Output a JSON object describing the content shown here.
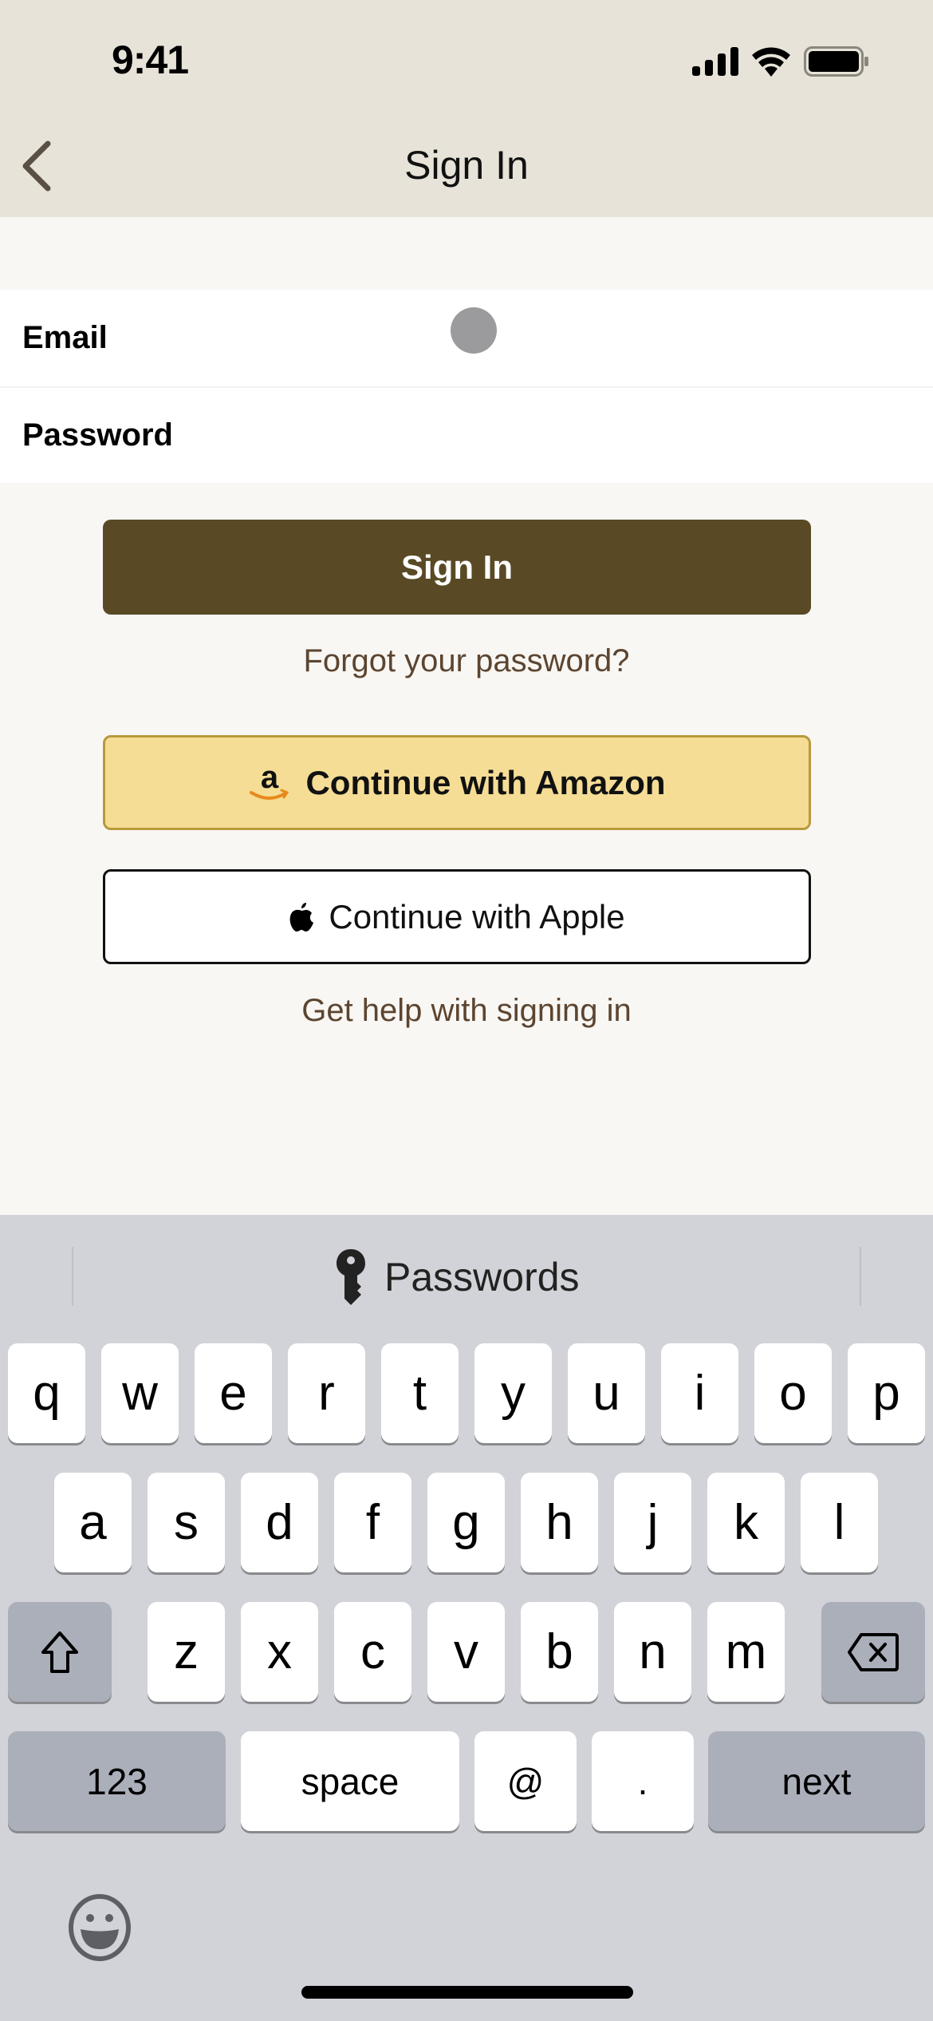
{
  "status_bar": {
    "time": "9:41"
  },
  "nav": {
    "title": "Sign In",
    "back_icon": "chevron-left-icon"
  },
  "form": {
    "email": {
      "label": "Email",
      "value": "",
      "placeholder": ""
    },
    "password": {
      "label": "Password",
      "value": "",
      "placeholder": ""
    }
  },
  "actions": {
    "sign_in": "Sign In",
    "forgot_password": "Forgot your password?",
    "amazon": "Continue with Amazon",
    "apple": "Continue with Apple",
    "help": "Get help with signing in"
  },
  "colors": {
    "header_bg": "#e7e3d8",
    "page_bg": "#f9f7f4",
    "primary": "#594a25",
    "amazon_bg": "#f5dd95",
    "amazon_border": "#b89a3e",
    "link": "#5c4530",
    "keyboard_bg": "#d2d3d8"
  },
  "keyboard": {
    "suggestion": "Passwords",
    "row1": [
      "q",
      "w",
      "e",
      "r",
      "t",
      "y",
      "u",
      "i",
      "o",
      "p"
    ],
    "row2": [
      "a",
      "s",
      "d",
      "f",
      "g",
      "h",
      "j",
      "k",
      "l"
    ],
    "row3": [
      "z",
      "x",
      "c",
      "v",
      "b",
      "n",
      "m"
    ],
    "numbers": "123",
    "space": "space",
    "at": "@",
    "dot": ".",
    "next": "next"
  }
}
